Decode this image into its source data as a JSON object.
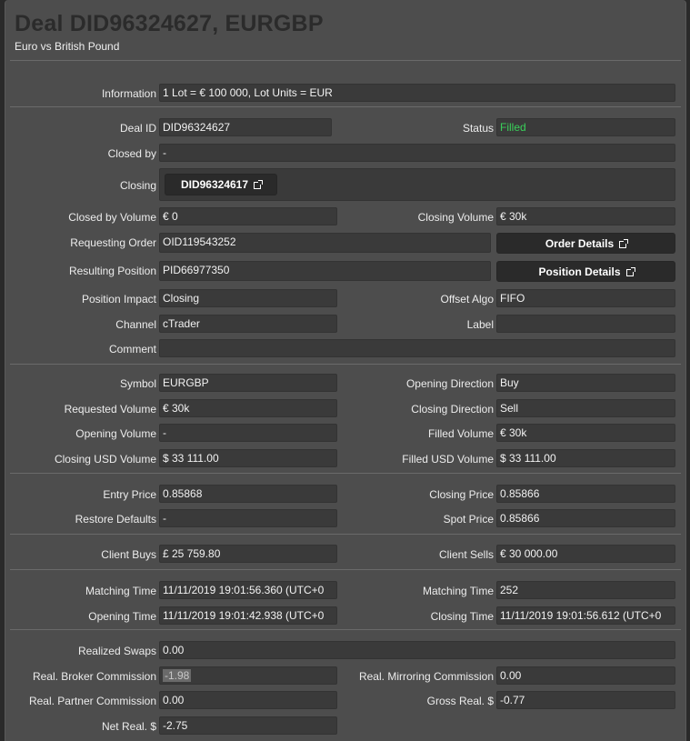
{
  "header": {
    "title": "Deal DID96324627, EURGBP",
    "subtitle": "Euro vs British Pound"
  },
  "info": {
    "label": "Information",
    "value": "1 Lot = € 100 000, Lot Units = EUR"
  },
  "deal": {
    "deal_id_label": "Deal ID",
    "deal_id": "DID96324627",
    "status_label": "Status",
    "status": "Filled",
    "status_color": "#39d05a",
    "closed_by_label": "Closed by",
    "closed_by": "-",
    "closing_label": "Closing",
    "closing_button": "DID96324617",
    "closed_by_volume_label": "Closed by Volume",
    "closed_by_volume": "€ 0",
    "closing_volume_label": "Closing Volume",
    "closing_volume": "€ 30k",
    "requesting_order_label": "Requesting Order",
    "requesting_order": "OID119543252",
    "order_details_button": "Order Details",
    "resulting_position_label": "Resulting Position",
    "resulting_position": "PID66977350",
    "position_details_button": "Position Details",
    "position_impact_label": "Position Impact",
    "position_impact": "Closing",
    "offset_algo_label": "Offset Algo",
    "offset_algo": "FIFO",
    "channel_label": "Channel",
    "channel": "cTrader",
    "label_label": "Label",
    "label": "",
    "comment_label": "Comment",
    "comment": ""
  },
  "volumes": {
    "symbol_label": "Symbol",
    "symbol": "EURGBP",
    "opening_direction_label": "Opening Direction",
    "opening_direction": "Buy",
    "requested_volume_label": "Requested Volume",
    "requested_volume": "€ 30k",
    "closing_direction_label": "Closing Direction",
    "closing_direction": "Sell",
    "opening_volume_label": "Opening Volume",
    "opening_volume": "-",
    "filled_volume_label": "Filled Volume",
    "filled_volume": "€ 30k",
    "closing_usd_volume_label": "Closing USD Volume",
    "closing_usd_volume": "$ 33 111.00",
    "filled_usd_volume_label": "Filled USD Volume",
    "filled_usd_volume": "$ 33 111.00"
  },
  "prices": {
    "entry_price_label": "Entry Price",
    "entry_price": "0.85868",
    "closing_price_label": "Closing Price",
    "closing_price": "0.85866",
    "restore_defaults_label": "Restore Defaults",
    "restore_defaults": "-",
    "spot_price_label": "Spot Price",
    "spot_price": "0.85866"
  },
  "clients": {
    "client_buys_label": "Client Buys",
    "client_buys": "£ 25 759.80",
    "client_sells_label": "Client Sells",
    "client_sells": "€ 30 000.00"
  },
  "times": {
    "matching_time_label": "Matching Time",
    "matching_time": "11/11/2019 19:01:56.360 (UTC+0",
    "matching_time2_label": "Matching Time",
    "matching_time2": "252",
    "opening_time_label": "Opening Time",
    "opening_time": "11/11/2019 19:01:42.938 (UTC+0",
    "closing_time_label": "Closing Time",
    "closing_time": "11/11/2019 19:01:56.612 (UTC+0"
  },
  "realized": {
    "realized_swaps_label": "Realized Swaps",
    "realized_swaps": "0.00",
    "broker_commission_label": "Real. Broker Commission",
    "broker_commission": "-1.98",
    "mirroring_commission_label": "Real. Mirroring Commission",
    "mirroring_commission": "0.00",
    "partner_commission_label": "Real. Partner Commission",
    "partner_commission": "0.00",
    "gross_real_label": "Gross Real. $",
    "gross_real": "-0.77",
    "net_real_label": "Net Real. $",
    "net_real": "-2.75"
  },
  "icons": {
    "external_link": "external-link-icon"
  }
}
